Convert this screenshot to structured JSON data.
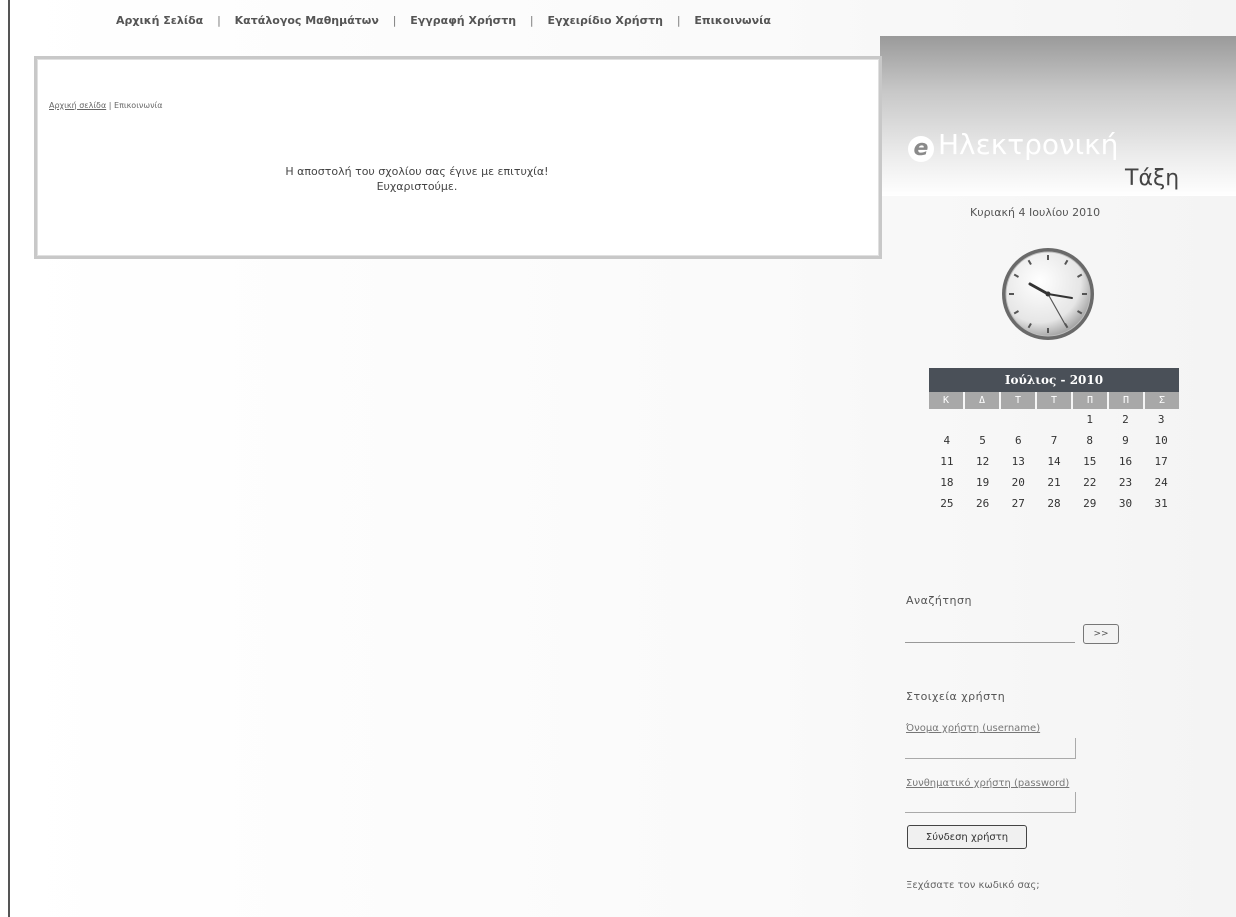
{
  "nav": {
    "items": [
      "Αρχική Σελίδα",
      "Κατάλογος Μαθημάτων",
      "Εγγραφή Χρήστη",
      "Εγχειρίδιο Χρήστη",
      "Επικοινωνία"
    ],
    "separator": "|"
  },
  "logo": {
    "mark": "e",
    "line1": "Ηλεκτρονική",
    "line2": "Τάξη"
  },
  "breadcrumb": {
    "home": "Αρχική σελίδα",
    "separator": "|",
    "current": "Επικοινωνία"
  },
  "message": {
    "line1": "Η αποστολή του σχολίου σας έγινε με επιτυχία!",
    "line2": "Ευχαριστούμε."
  },
  "sidebar": {
    "date": "Κυριακή 4 Ιουλίου 2010",
    "calendar": {
      "title": "Ιούλιος - 2010",
      "weekdays": [
        "Κ",
        "Δ",
        "Τ",
        "Τ",
        "Π",
        "Π",
        "Σ"
      ],
      "weeks": [
        [
          "",
          "",
          "",
          "",
          "1",
          "2",
          "3"
        ],
        [
          "4",
          "5",
          "6",
          "7",
          "8",
          "9",
          "10"
        ],
        [
          "11",
          "12",
          "13",
          "14",
          "15",
          "16",
          "17"
        ],
        [
          "18",
          "19",
          "20",
          "21",
          "22",
          "23",
          "24"
        ],
        [
          "25",
          "26",
          "27",
          "28",
          "29",
          "30",
          "31"
        ]
      ]
    },
    "search": {
      "label": "Αναζήτηση",
      "value": "",
      "button": ">>"
    },
    "user": {
      "title": "Στοιχεία χρήστη",
      "username_label": "Όνομα χρήστη (username)",
      "username_value": "",
      "password_label": "Συνθηματικό χρήστη (password)",
      "password_value": "",
      "login_button": "Σύνδεση χρήστη",
      "forgot": "Ξεχάσατε τον κωδικό σας;"
    }
  },
  "icons": {
    "clock": "analog-clock-icon",
    "logo": "e-logo-icon"
  },
  "colors": {
    "calendar_header": "#4a5058",
    "calendar_weekday": "#a8a8a8"
  }
}
